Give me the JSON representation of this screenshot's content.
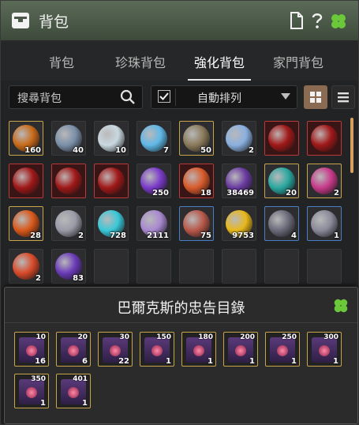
{
  "window": {
    "title": "背包"
  },
  "tabs": [
    {
      "label": "背包"
    },
    {
      "label": "珍珠背包"
    },
    {
      "label": "強化背包"
    },
    {
      "label": "家門背包"
    }
  ],
  "toolbar": {
    "search_placeholder": "搜尋背包",
    "sort_label": "自動排列",
    "sort_checked": true
  },
  "items": [
    {
      "count": "160",
      "rarity": "gold",
      "color": "#c86a1a",
      "icon": "black-stone-orb"
    },
    {
      "count": "40",
      "rarity": "none",
      "color": "#7a8fa8",
      "icon": "stone-chunk"
    },
    {
      "count": "10",
      "rarity": "none",
      "color": "#c9d8e0",
      "icon": "silver-orb"
    },
    {
      "count": "7",
      "rarity": "none",
      "color": "#5fb8e8",
      "icon": "blue-shard"
    },
    {
      "count": "50",
      "rarity": "gold",
      "color": "#8a7a5a",
      "icon": "ore-chunk"
    },
    {
      "count": "2",
      "rarity": "none",
      "color": "#8ab0e0",
      "icon": "crystal-ball"
    },
    {
      "count": "",
      "rarity": "red",
      "color": "#a01818",
      "icon": "red-claw"
    },
    {
      "count": "",
      "rarity": "red",
      "color": "#a01818",
      "icon": "red-claw"
    },
    {
      "count": "",
      "rarity": "red",
      "color": "#a01818",
      "icon": "red-claw"
    },
    {
      "count": "",
      "rarity": "red",
      "color": "#a01818",
      "icon": "red-claw"
    },
    {
      "count": "",
      "rarity": "red",
      "color": "#a01818",
      "icon": "red-claw"
    },
    {
      "count": "250",
      "rarity": "none",
      "color": "#7a3ac8",
      "icon": "purple-shard"
    },
    {
      "count": "18",
      "rarity": "red",
      "color": "#d85a2a",
      "icon": "fire-shard"
    },
    {
      "count": "38469",
      "rarity": "none",
      "color": "#6a3aa0",
      "icon": "dark-shard"
    },
    {
      "count": "20",
      "rarity": "gold",
      "color": "#2aa8a0",
      "icon": "teal-orb"
    },
    {
      "count": "2",
      "rarity": "gold",
      "color": "#c83a8a",
      "icon": "spiral-orb"
    },
    {
      "count": "28",
      "rarity": "gold",
      "color": "#d8581a",
      "icon": "lava-orb"
    },
    {
      "count": "2",
      "rarity": "none",
      "color": "#9a9aa8",
      "icon": "silver-shard"
    },
    {
      "count": "728",
      "rarity": "none",
      "color": "#3ac8d8",
      "icon": "cyan-orb"
    },
    {
      "count": "2111",
      "rarity": "none",
      "color": "#a888d0",
      "icon": "pearl-stone"
    },
    {
      "count": "75",
      "rarity": "blue",
      "color": "#b8584a",
      "icon": "copper-stone"
    },
    {
      "count": "9753",
      "rarity": "none",
      "color": "#e8b81a",
      "icon": "gold-flame"
    },
    {
      "count": "4",
      "rarity": "blue",
      "color": "#6a6a7a",
      "icon": "amulet"
    },
    {
      "count": "1",
      "rarity": "blue",
      "color": "#8a8a9a",
      "icon": "pendant"
    },
    {
      "count": "2",
      "rarity": "none",
      "color": "#d84a2a",
      "icon": "red-orb"
    },
    {
      "count": "83",
      "rarity": "none",
      "color": "#6a3ab8",
      "icon": "violet-stone"
    },
    {
      "count": "",
      "rarity": "empty",
      "color": "",
      "icon": ""
    },
    {
      "count": "",
      "rarity": "empty",
      "color": "",
      "icon": ""
    },
    {
      "count": "",
      "rarity": "empty",
      "color": "",
      "icon": ""
    },
    {
      "count": "",
      "rarity": "empty",
      "color": "",
      "icon": ""
    },
    {
      "count": "",
      "rarity": "empty",
      "color": "",
      "icon": ""
    },
    {
      "count": "",
      "rarity": "empty",
      "color": "",
      "icon": ""
    }
  ],
  "panel": {
    "title": "巴爾克斯的忠告目錄",
    "books": [
      {
        "top": "10",
        "count": "16"
      },
      {
        "top": "20",
        "count": "6"
      },
      {
        "top": "30",
        "count": "22"
      },
      {
        "top": "150",
        "count": "1"
      },
      {
        "top": "180",
        "count": "1"
      },
      {
        "top": "200",
        "count": "1"
      },
      {
        "top": "250",
        "count": "1"
      },
      {
        "top": "300",
        "count": "1"
      },
      {
        "top": "350",
        "count": "1"
      },
      {
        "top": "401",
        "count": "1"
      }
    ]
  }
}
